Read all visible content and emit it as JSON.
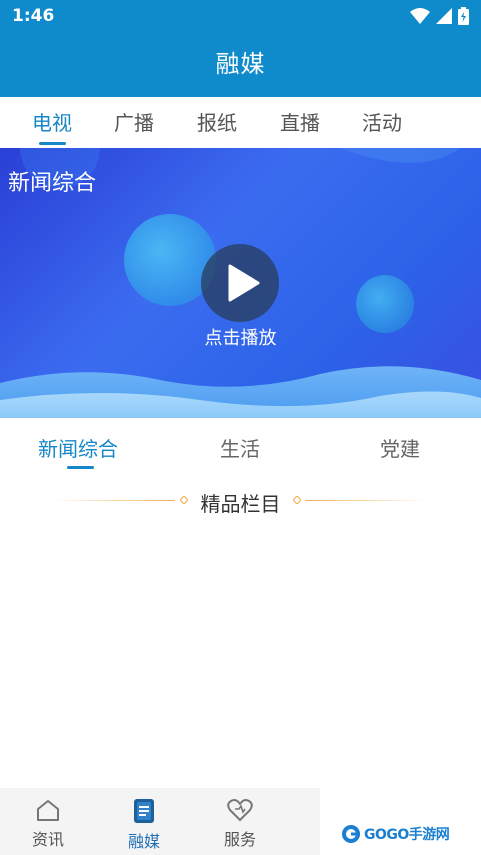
{
  "status_bar": {
    "time": "1:46",
    "icons": [
      "wifi-icon",
      "signal-icon",
      "battery-icon"
    ]
  },
  "header": {
    "title": "融媒"
  },
  "tabs": [
    {
      "label": "电视",
      "active": true
    },
    {
      "label": "广播",
      "active": false
    },
    {
      "label": "报纸",
      "active": false
    },
    {
      "label": "直播",
      "active": false
    },
    {
      "label": "活动",
      "active": false
    }
  ],
  "player": {
    "channel_title": "新闻综合",
    "play_label": "点击播放"
  },
  "subtabs": [
    {
      "label": "新闻综合",
      "active": true
    },
    {
      "label": "生活",
      "active": false
    },
    {
      "label": "党建",
      "active": false
    }
  ],
  "section": {
    "title": "精品栏目"
  },
  "bottom_nav": [
    {
      "label": "资讯",
      "icon": "home-icon",
      "active": false
    },
    {
      "label": "融媒",
      "icon": "media-icon",
      "active": true
    },
    {
      "label": "服务",
      "icon": "heart-icon",
      "active": false
    }
  ],
  "watermark": {
    "text": "GOGO手游网"
  },
  "colors": {
    "primary": "#0f8bcc",
    "accent": "#1586c7",
    "gold": "#f0b45a"
  }
}
